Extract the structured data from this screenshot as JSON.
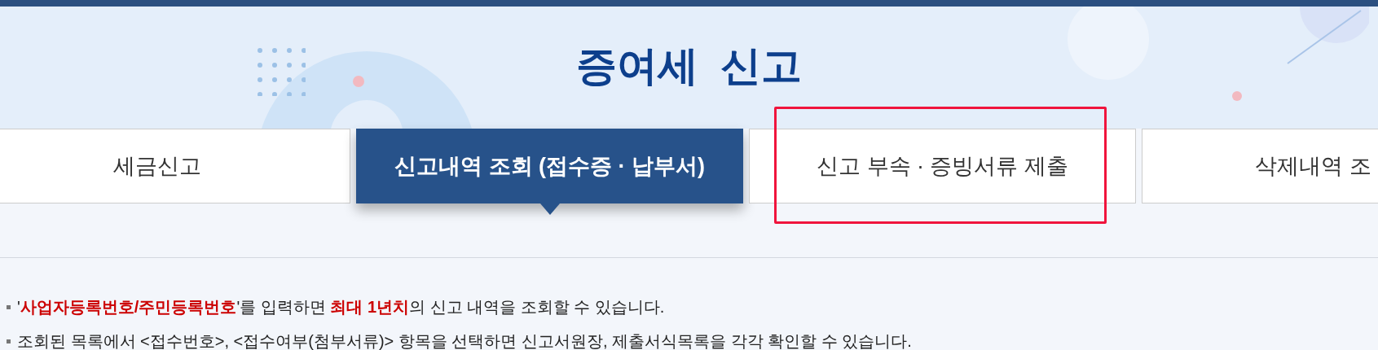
{
  "page_title": "증여세  신고",
  "tabs": [
    {
      "label": "세금신고",
      "selected": false,
      "highlighted": false
    },
    {
      "label": "신고내역 조회 (접수증 · 납부서)",
      "selected": true,
      "highlighted": false
    },
    {
      "label": "신고 부속 · 증빙서류 제출",
      "selected": false,
      "highlighted": true
    },
    {
      "label": "삭제내역 조",
      "selected": false,
      "highlighted": false
    }
  ],
  "notes": [
    "'**사업자등록번호/주민등록번호**'를 입력하면 **최대 1년치**의 신고 내역을 조회할 수 있습니다.",
    "조회된 목록에서 <접수번호>, <접수여부(첨부서류)> 항목을 선택하면 신고서원장, 제출서식목록을 각각 확인할 수 있습니다."
  ]
}
